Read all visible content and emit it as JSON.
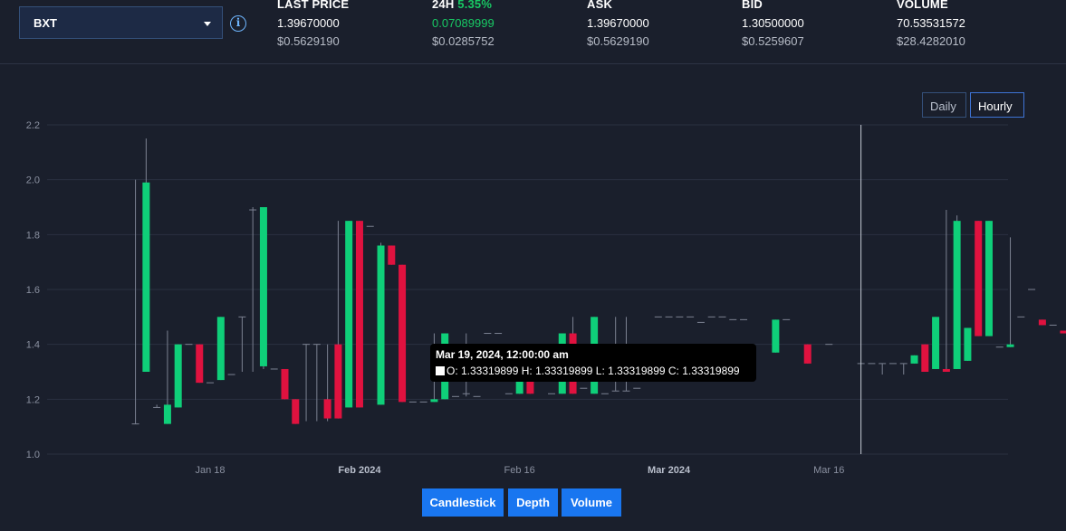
{
  "market": {
    "selected": "BXT"
  },
  "stats": {
    "last_price": {
      "label": "LAST PRICE",
      "value": "1.39670000",
      "usd": "$0.5629190"
    },
    "change_24h": {
      "label": "24H",
      "pct": "5.35%",
      "value": "0.07089999",
      "usd": "$0.0285752"
    },
    "ask": {
      "label": "ASK",
      "value": "1.39670000",
      "usd": "$0.5629190"
    },
    "bid": {
      "label": "BID",
      "value": "1.30500000",
      "usd": "$0.5259607"
    },
    "volume": {
      "label": "VOLUME",
      "value": "70.53531572",
      "usd": "$28.4282010"
    }
  },
  "range": {
    "daily": "Daily",
    "hourly": "Hourly"
  },
  "tooltip": {
    "date": "Mar 19, 2024, 12:00:00 am",
    "ohlc": "O: 1.33319899  H: 1.33319899  L: 1.33319899  C: 1.33319899"
  },
  "chart_tabs": {
    "candlestick": "Candlestick",
    "depth": "Depth",
    "volume": "Volume"
  },
  "colors": {
    "up": "#0fcf79",
    "down": "#e0123f",
    "wick": "#7c8292",
    "grid": "#2a3040"
  },
  "chart_data": {
    "type": "candlestick",
    "title": "",
    "ylim": [
      1.0,
      2.2
    ],
    "yticks": [
      1.0,
      1.2,
      1.4,
      1.6,
      1.8,
      2.0,
      2.2
    ],
    "xticks": [
      {
        "day": 18,
        "label": "Jan 18",
        "bold": false
      },
      {
        "day": 32,
        "label": "Feb 2024",
        "bold": true
      },
      {
        "day": 47,
        "label": "Feb 16",
        "bold": false
      },
      {
        "day": 61,
        "label": "Mar 2024",
        "bold": true
      },
      {
        "day": 76,
        "label": "Mar 16",
        "bold": false
      }
    ],
    "crosshair_day": 79,
    "candles": [
      {
        "d": 11,
        "o": 1.11,
        "h": 2.0,
        "l": 1.11,
        "c": 1.11
      },
      {
        "d": 12,
        "o": 1.3,
        "h": 2.15,
        "l": 1.3,
        "c": 1.99
      },
      {
        "d": 13,
        "o": 1.17,
        "h": 1.18,
        "l": 1.17,
        "c": 1.17
      },
      {
        "d": 14,
        "o": 1.11,
        "h": 1.45,
        "l": 1.11,
        "c": 1.18
      },
      {
        "d": 15,
        "o": 1.17,
        "h": 1.4,
        "l": 1.17,
        "c": 1.4
      },
      {
        "d": 16,
        "o": 1.4,
        "h": 1.4,
        "l": 1.4,
        "c": 1.4
      },
      {
        "d": 17,
        "o": 1.4,
        "h": 1.4,
        "l": 1.26,
        "c": 1.26
      },
      {
        "d": 18,
        "o": 1.26,
        "h": 1.26,
        "l": 1.26,
        "c": 1.26
      },
      {
        "d": 19,
        "o": 1.27,
        "h": 1.5,
        "l": 1.27,
        "c": 1.5
      },
      {
        "d": 20,
        "o": 1.29,
        "h": 1.29,
        "l": 1.29,
        "c": 1.29
      },
      {
        "d": 21,
        "o": 1.5,
        "h": 1.5,
        "l": 1.3,
        "c": 1.5
      },
      {
        "d": 22,
        "o": 1.89,
        "h": 1.9,
        "l": 1.3,
        "c": 1.89
      },
      {
        "d": 23,
        "o": 1.32,
        "h": 1.9,
        "l": 1.31,
        "c": 1.9
      },
      {
        "d": 24,
        "o": 1.31,
        "h": 1.31,
        "l": 1.31,
        "c": 1.31
      },
      {
        "d": 25,
        "o": 1.31,
        "h": 1.31,
        "l": 1.2,
        "c": 1.2
      },
      {
        "d": 26,
        "o": 1.2,
        "h": 1.2,
        "l": 1.11,
        "c": 1.11
      },
      {
        "d": 27,
        "o": 1.4,
        "h": 1.4,
        "l": 1.12,
        "c": 1.4
      },
      {
        "d": 28,
        "o": 1.4,
        "h": 1.4,
        "l": 1.12,
        "c": 1.4
      },
      {
        "d": 29,
        "o": 1.2,
        "h": 1.4,
        "l": 1.12,
        "c": 1.13
      },
      {
        "d": 30,
        "o": 1.4,
        "h": 1.85,
        "l": 1.13,
        "c": 1.13
      },
      {
        "d": 31,
        "o": 1.17,
        "h": 1.85,
        "l": 1.17,
        "c": 1.85
      },
      {
        "d": 32,
        "o": 1.85,
        "h": 1.85,
        "l": 1.17,
        "c": 1.17
      },
      {
        "d": 33,
        "o": 1.83,
        "h": 1.83,
        "l": 1.83,
        "c": 1.83
      },
      {
        "d": 34,
        "o": 1.18,
        "h": 1.77,
        "l": 1.18,
        "c": 1.76
      },
      {
        "d": 35,
        "o": 1.76,
        "h": 1.76,
        "l": 1.69,
        "c": 1.69
      },
      {
        "d": 36,
        "o": 1.69,
        "h": 1.69,
        "l": 1.19,
        "c": 1.19
      },
      {
        "d": 37,
        "o": 1.19,
        "h": 1.19,
        "l": 1.19,
        "c": 1.19
      },
      {
        "d": 38,
        "o": 1.19,
        "h": 1.19,
        "l": 1.19,
        "c": 1.19
      },
      {
        "d": 39,
        "o": 1.19,
        "h": 1.44,
        "l": 1.19,
        "c": 1.2
      },
      {
        "d": 40,
        "o": 1.2,
        "h": 1.44,
        "l": 1.2,
        "c": 1.44
      },
      {
        "d": 41,
        "o": 1.21,
        "h": 1.21,
        "l": 1.21,
        "c": 1.21
      },
      {
        "d": 42,
        "o": 1.22,
        "h": 1.44,
        "l": 1.21,
        "c": 1.22
      },
      {
        "d": 43,
        "o": 1.21,
        "h": 1.21,
        "l": 1.21,
        "c": 1.21
      },
      {
        "d": 44,
        "o": 1.44,
        "h": 1.44,
        "l": 1.44,
        "c": 1.44
      },
      {
        "d": 45,
        "o": 1.44,
        "h": 1.44,
        "l": 1.44,
        "c": 1.44
      },
      {
        "d": 46,
        "o": 1.22,
        "h": 1.22,
        "l": 1.22,
        "c": 1.22
      },
      {
        "d": 47,
        "o": 1.22,
        "h": 1.3,
        "l": 1.22,
        "c": 1.3
      },
      {
        "d": 48,
        "o": 1.3,
        "h": 1.3,
        "l": 1.22,
        "c": 1.22
      },
      {
        "d": 49,
        "o": 1.3,
        "h": 1.3,
        "l": 1.3,
        "c": 1.3
      },
      {
        "d": 50,
        "o": 1.22,
        "h": 1.22,
        "l": 1.22,
        "c": 1.22
      },
      {
        "d": 51,
        "o": 1.22,
        "h": 1.44,
        "l": 1.22,
        "c": 1.44
      },
      {
        "d": 52,
        "o": 1.44,
        "h": 1.5,
        "l": 1.22,
        "c": 1.22
      },
      {
        "d": 53,
        "o": 1.24,
        "h": 1.24,
        "l": 1.24,
        "c": 1.24
      },
      {
        "d": 54,
        "o": 1.22,
        "h": 1.5,
        "l": 1.22,
        "c": 1.5
      },
      {
        "d": 55,
        "o": 1.22,
        "h": 1.22,
        "l": 1.22,
        "c": 1.22
      },
      {
        "d": 56,
        "o": 1.23,
        "h": 1.5,
        "l": 1.23,
        "c": 1.23
      },
      {
        "d": 57,
        "o": 1.23,
        "h": 1.5,
        "l": 1.23,
        "c": 1.23
      },
      {
        "d": 58,
        "o": 1.24,
        "h": 1.24,
        "l": 1.24,
        "c": 1.24
      },
      {
        "d": 60,
        "o": 1.5,
        "h": 1.5,
        "l": 1.5,
        "c": 1.5
      },
      {
        "d": 61,
        "o": 1.5,
        "h": 1.5,
        "l": 1.5,
        "c": 1.5
      },
      {
        "d": 62,
        "o": 1.5,
        "h": 1.5,
        "l": 1.5,
        "c": 1.5
      },
      {
        "d": 63,
        "o": 1.5,
        "h": 1.5,
        "l": 1.5,
        "c": 1.5
      },
      {
        "d": 64,
        "o": 1.48,
        "h": 1.48,
        "l": 1.48,
        "c": 1.48
      },
      {
        "d": 65,
        "o": 1.5,
        "h": 1.5,
        "l": 1.5,
        "c": 1.5
      },
      {
        "d": 66,
        "o": 1.5,
        "h": 1.5,
        "l": 1.5,
        "c": 1.5
      },
      {
        "d": 67,
        "o": 1.49,
        "h": 1.49,
        "l": 1.49,
        "c": 1.49
      },
      {
        "d": 68,
        "o": 1.49,
        "h": 1.49,
        "l": 1.49,
        "c": 1.49
      },
      {
        "d": 71,
        "o": 1.37,
        "h": 1.49,
        "l": 1.37,
        "c": 1.49
      },
      {
        "d": 72,
        "o": 1.49,
        "h": 1.49,
        "l": 1.49,
        "c": 1.49
      },
      {
        "d": 74,
        "o": 1.4,
        "h": 1.4,
        "l": 1.33,
        "c": 1.33
      },
      {
        "d": 76,
        "o": 1.4,
        "h": 1.4,
        "l": 1.4,
        "c": 1.4
      },
      {
        "d": 79,
        "o": 1.33,
        "h": 1.33,
        "l": 1.33,
        "c": 1.33
      },
      {
        "d": 80,
        "o": 1.33,
        "h": 1.33,
        "l": 1.33,
        "c": 1.33
      },
      {
        "d": 81,
        "o": 1.33,
        "h": 1.33,
        "l": 1.29,
        "c": 1.33
      },
      {
        "d": 82,
        "o": 1.33,
        "h": 1.33,
        "l": 1.33,
        "c": 1.33
      },
      {
        "d": 83,
        "o": 1.33,
        "h": 1.33,
        "l": 1.29,
        "c": 1.33
      },
      {
        "d": 84,
        "o": 1.33,
        "h": 1.36,
        "l": 1.33,
        "c": 1.36
      },
      {
        "d": 85,
        "o": 1.4,
        "h": 1.4,
        "l": 1.3,
        "c": 1.3
      },
      {
        "d": 86,
        "o": 1.31,
        "h": 1.5,
        "l": 1.31,
        "c": 1.5
      },
      {
        "d": 87,
        "o": 1.31,
        "h": 1.89,
        "l": 1.3,
        "c": 1.3
      },
      {
        "d": 88,
        "o": 1.31,
        "h": 1.87,
        "l": 1.31,
        "c": 1.85
      },
      {
        "d": 89,
        "o": 1.34,
        "h": 1.46,
        "l": 1.34,
        "c": 1.46
      },
      {
        "d": 90,
        "o": 1.85,
        "h": 1.85,
        "l": 1.43,
        "c": 1.43
      },
      {
        "d": 91,
        "o": 1.43,
        "h": 1.85,
        "l": 1.43,
        "c": 1.85
      },
      {
        "d": 92,
        "o": 1.39,
        "h": 1.39,
        "l": 1.39,
        "c": 1.39
      },
      {
        "d": 93,
        "o": 1.39,
        "h": 1.79,
        "l": 1.39,
        "c": 1.4
      },
      {
        "d": 94,
        "o": 1.5,
        "h": 1.5,
        "l": 1.5,
        "c": 1.5
      },
      {
        "d": 95,
        "o": 1.6,
        "h": 1.6,
        "l": 1.6,
        "c": 1.6
      },
      {
        "d": 96,
        "o": 1.49,
        "h": 1.49,
        "l": 1.47,
        "c": 1.47
      },
      {
        "d": 97,
        "o": 1.47,
        "h": 1.47,
        "l": 1.47,
        "c": 1.47
      },
      {
        "d": 98,
        "o": 1.45,
        "h": 1.45,
        "l": 1.44,
        "c": 1.44
      },
      {
        "d": 99,
        "o": 1.44,
        "h": 1.44,
        "l": 1.44,
        "c": 1.44
      },
      {
        "d": 100,
        "o": 1.44,
        "h": 1.44,
        "l": 1.33,
        "c": 1.33
      },
      {
        "d": 101,
        "o": 1.44,
        "h": 1.44,
        "l": 1.44,
        "c": 1.44
      },
      {
        "d": 102,
        "o": 1.32,
        "h": 1.32,
        "l": 1.32,
        "c": 1.32
      },
      {
        "d": 103,
        "o": 1.4,
        "h": 1.4,
        "l": 1.4,
        "c": 1.4
      }
    ]
  }
}
